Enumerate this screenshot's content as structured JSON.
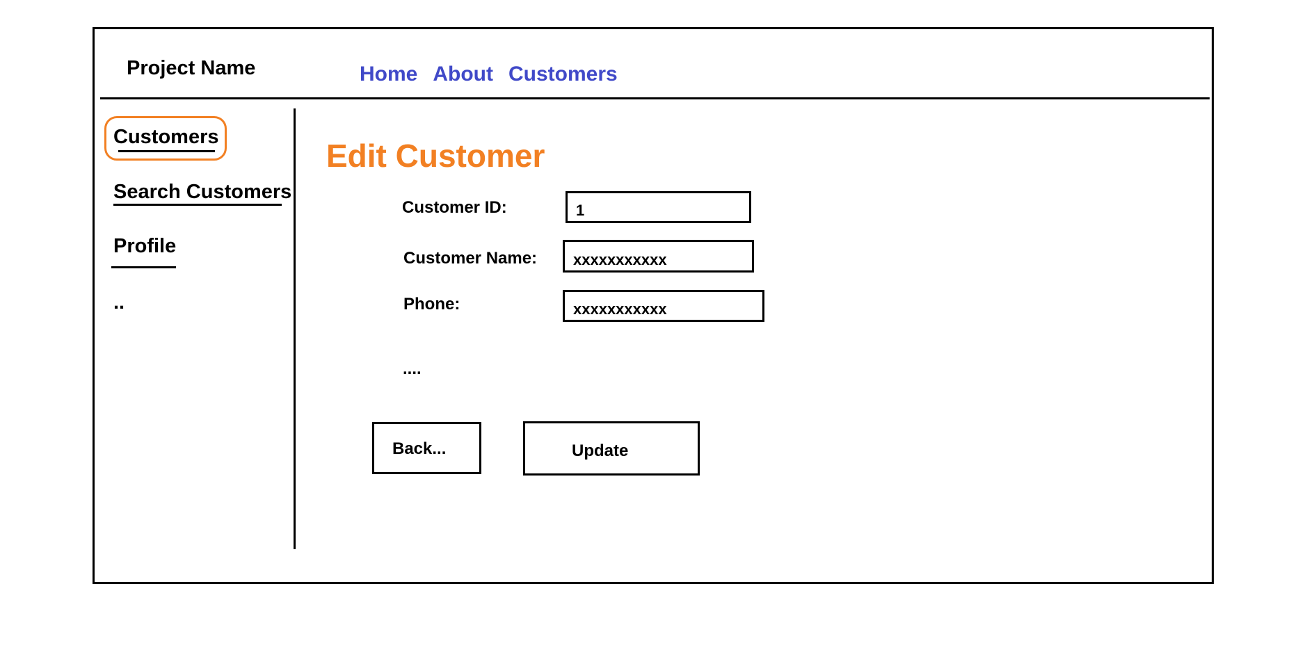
{
  "header": {
    "project_name": "Project Name",
    "nav": [
      "Home",
      "About",
      "Customers"
    ]
  },
  "sidebar": {
    "items": [
      "Customers",
      "Search Customers",
      "Profile"
    ],
    "more": "..",
    "active_item": "Customers",
    "active_color": "#f28023"
  },
  "main": {
    "title": "Edit Customer",
    "title_color": "#f28023",
    "fields": [
      {
        "label": "Customer ID:",
        "value": "1"
      },
      {
        "label": "Customer Name:",
        "value": "xxxxxxxxxxx"
      },
      {
        "label": "Phone:",
        "value": "xxxxxxxxxxx"
      }
    ],
    "more_fields": "....",
    "buttons": {
      "back": "Back...",
      "update": "Update"
    }
  },
  "colors": {
    "nav_link": "#4049c8",
    "accent": "#f28023"
  }
}
